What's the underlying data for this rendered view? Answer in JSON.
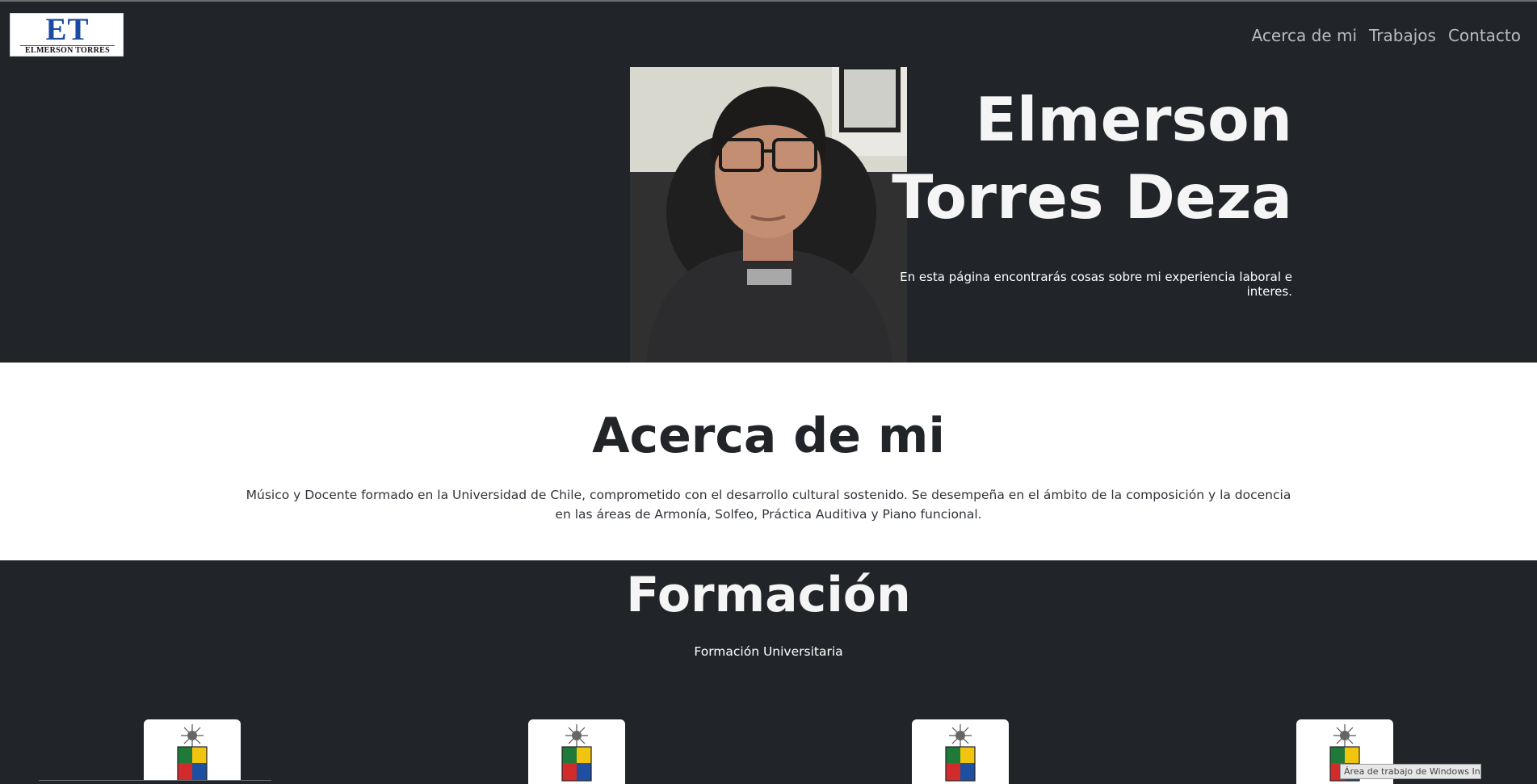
{
  "header": {
    "logo": {
      "monogram": "ET",
      "brand_text": "ELMERSON TORRES"
    },
    "nav": [
      {
        "label": "Acerca de mi"
      },
      {
        "label": "Trabajos"
      },
      {
        "label": "Contacto"
      }
    ]
  },
  "hero": {
    "title_line1": "Elmerson",
    "title_line2": "Torres Deza",
    "subtitle": "En esta página encontrarás cosas sobre mi experiencia laboral e interes."
  },
  "about": {
    "heading": "Acerca de mi",
    "body": "Músico y Docente formado en la Universidad de Chile, comprometido con el desarrollo cultural sostenido. Se desempeña en el ámbito de la composición y la docencia en las áreas de Armonía, Solfeo, Práctica Auditiva y Piano funcional."
  },
  "formation": {
    "heading": "Formación",
    "subtitle": "Formación Universitaria",
    "cards": [
      {
        "icon": "university-crest-icon"
      },
      {
        "icon": "university-crest-icon"
      },
      {
        "icon": "university-crest-icon"
      },
      {
        "icon": "university-crest-icon"
      }
    ]
  },
  "overlay": {
    "tooltip": "Área de trabajo de Windows Ink"
  },
  "colors": {
    "dark_bg": "#212529",
    "light_bg": "#ffffff",
    "nav_text": "#b8bcc1",
    "logo_blue": "#1b4aa5"
  }
}
